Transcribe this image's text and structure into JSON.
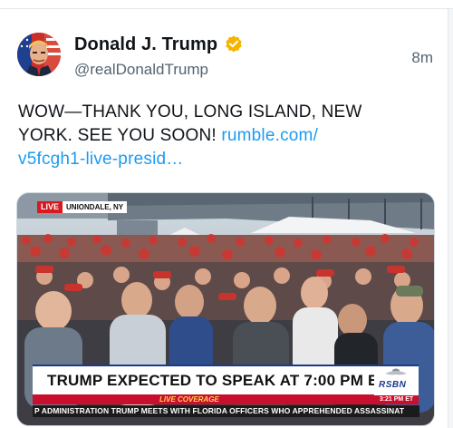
{
  "post": {
    "author": {
      "display_name": "Donald J. Trump",
      "handle": "@realDonaldTrump",
      "verified": true,
      "verified_badge_color": "#f4b400"
    },
    "timestamp": "8m",
    "text": "WOW—THANK YOU, LONG ISLAND, NEW YORK. SEE YOU SOON!",
    "link": {
      "label_line1": "rumble.com/",
      "label_line2": "v5fcgh1-live-presid…"
    },
    "link_color": "#1d9bf0",
    "media": {
      "live_badge": "LIVE",
      "location": "UNIONDALE, NY",
      "headline": "TRUMP EXPECTED TO SPEAK AT 7:00 PM ET",
      "live_coverage": "LIVE COVERAGE",
      "network_logo": "RSBN",
      "time": "3:21 PM ET",
      "ticker": "P ADMINISTRATION    TRUMP MEETS WITH FLORIDA OFFICERS WHO APPREHENDED ASSASSINAT",
      "accent_red": "#c8102e",
      "accent_blue": "#1a3a8a"
    }
  }
}
